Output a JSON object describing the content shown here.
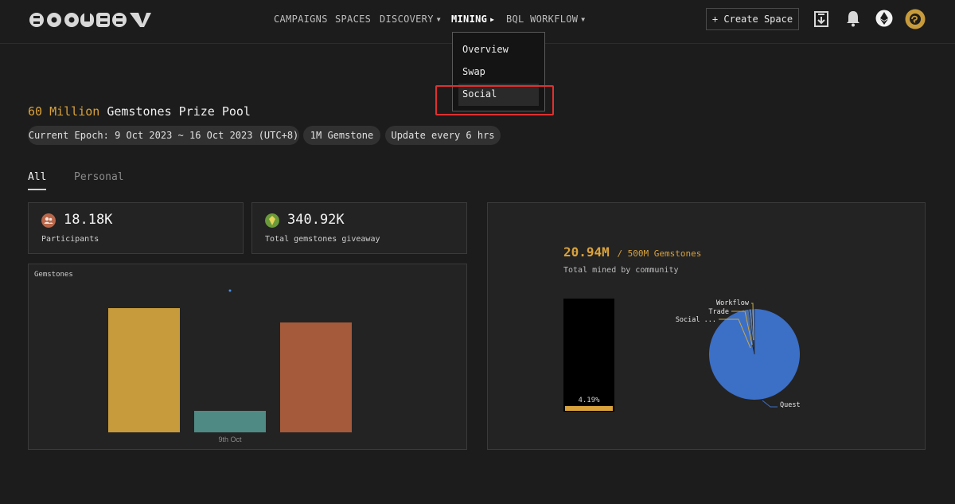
{
  "header": {
    "logo_text": "SOQUEST",
    "nav": [
      {
        "label": "CAMPAIGNS",
        "caret": ""
      },
      {
        "label": "SPACES",
        "caret": ""
      },
      {
        "label": "DISCOVERY",
        "caret": "▼"
      },
      {
        "label": "MINING",
        "caret": "▶"
      },
      {
        "label": "BQL WORKFLOW",
        "caret": "▼"
      }
    ],
    "create_button": "+ Create Space",
    "icons": [
      "download-icon",
      "bell-icon",
      "ethereum-icon",
      "avatar"
    ]
  },
  "dropdown": {
    "items": [
      "Overview",
      "Swap",
      "Social"
    ],
    "highlighted": "Social"
  },
  "pool": {
    "amount": "60 Million",
    "title_rest": "Gemstones Prize Pool",
    "pills": [
      "Current Epoch: 9 Oct 2023 ~ 16 Oct 2023 (UTC+8)",
      "1M Gemstone",
      "Update every 6 hrs"
    ]
  },
  "tabs": {
    "all": "All",
    "personal": "Personal"
  },
  "stats": {
    "participants": {
      "value": "18.18K",
      "label": "Participants"
    },
    "giveaway": {
      "value": "340.92K",
      "label": "Total gemstones giveaway"
    }
  },
  "mined": {
    "value": "20.94M",
    "of": "/ 500M Gemstones",
    "label": "Total mined by community"
  },
  "colors": {
    "accent": "#d9a23c",
    "bar1": "#c79b3b",
    "bar2": "#4f8a84",
    "bar3": "#a55a3b",
    "pie": "#3c6fc6",
    "highlight_box": "#e0302f"
  },
  "chart_data": [
    {
      "type": "bar",
      "title": "Gemstones",
      "categories": [
        "9th Oct"
      ],
      "series": [
        {
          "values": [
            5.2
          ]
        },
        {
          "values": [
            0.9
          ]
        },
        {
          "values": [
            4.6
          ]
        }
      ],
      "ylim": [
        0,
        6
      ],
      "grid": false
    },
    {
      "type": "bar",
      "categories": [
        ""
      ],
      "values": [
        4.19
      ],
      "value_label": "4.19%",
      "ylim": [
        0,
        100
      ]
    },
    {
      "type": "pie",
      "labels": [
        "Quest",
        "Social ...",
        "Trade",
        "Workflow"
      ],
      "values": [
        96.5,
        1.5,
        1.0,
        1.0
      ]
    }
  ]
}
